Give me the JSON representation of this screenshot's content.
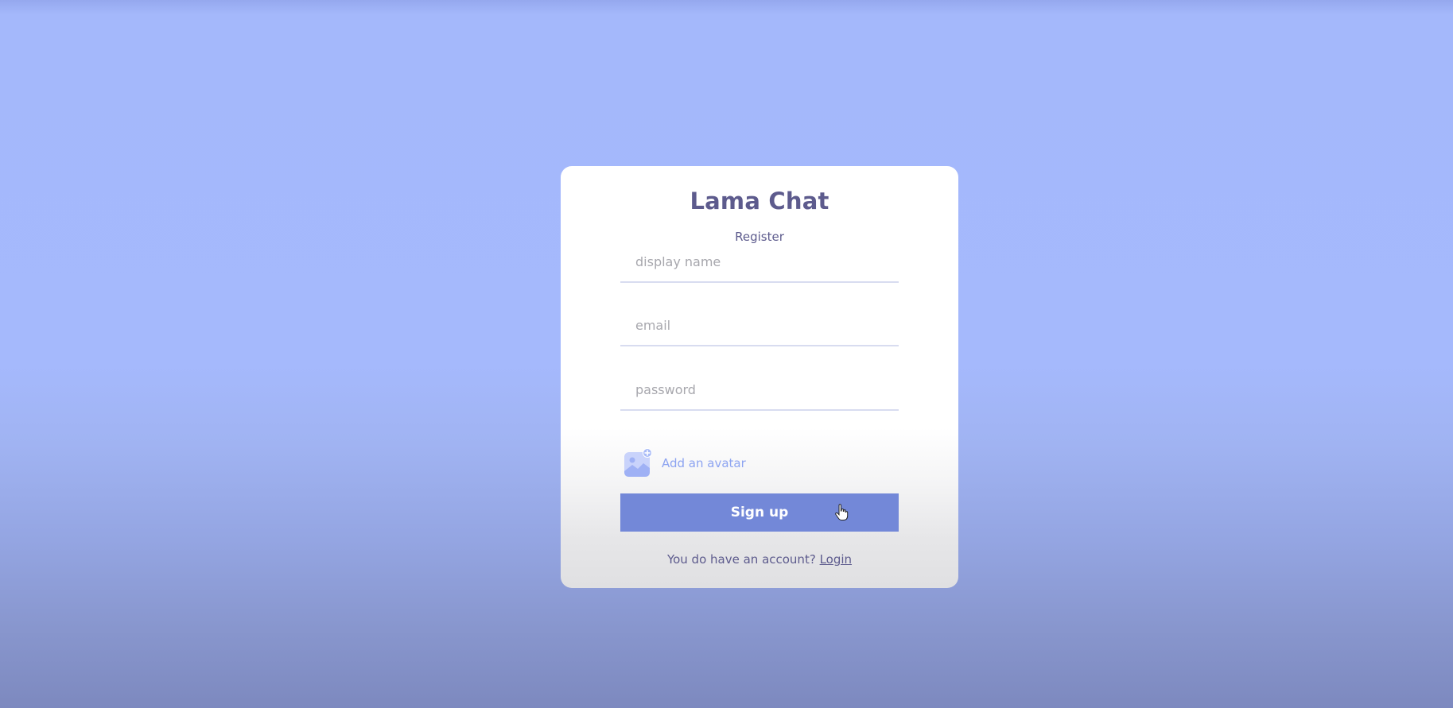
{
  "app": {
    "title": "Lama Chat",
    "subtitle": "Register"
  },
  "form": {
    "display_name": {
      "placeholder": "display name",
      "value": ""
    },
    "email": {
      "placeholder": "email",
      "value": ""
    },
    "password": {
      "placeholder": "password",
      "value": ""
    },
    "avatar_label": "Add an avatar",
    "avatar_icon": "image-add-icon",
    "submit_label": "Sign up"
  },
  "footer": {
    "prompt": "You do have an account?",
    "link_label": "Login"
  },
  "colors": {
    "background": "#a5b9fc",
    "primary_text": "#5d5b8d",
    "button": "#7388d8",
    "accent": "#8da4f1"
  }
}
